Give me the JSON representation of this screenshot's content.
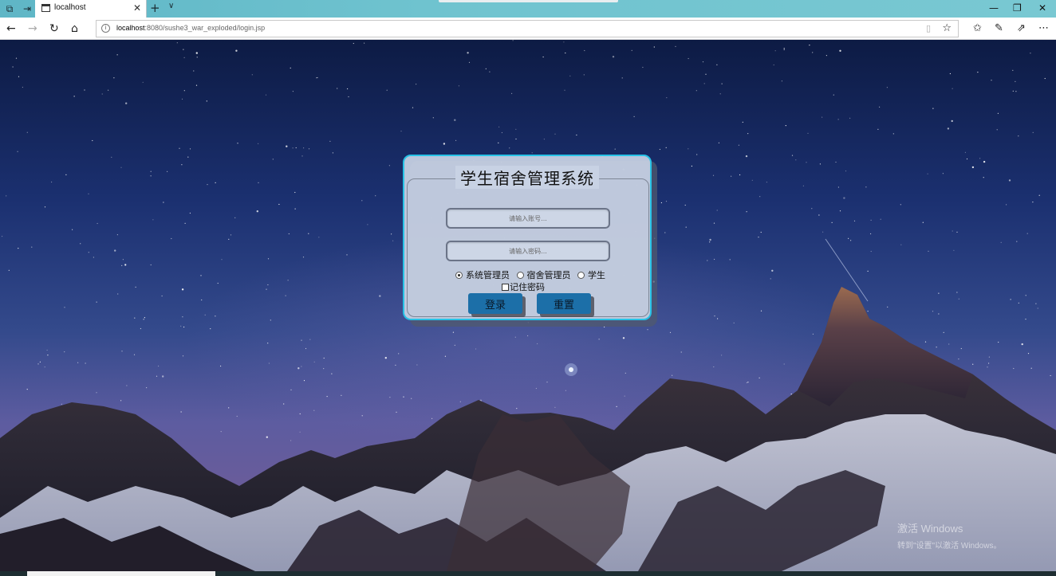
{
  "browser": {
    "tab_title": "localhost",
    "tab_close": "✕",
    "new_tab": "+",
    "tab_menu": "∨",
    "url_host": "localhost",
    "url_path": ":8080/sushe3_war_exploded/login.jsp",
    "window_controls": {
      "minimize": "—",
      "restore": "❐",
      "close": "✕"
    },
    "icons": {
      "tab_actions": "set-aside-tabs-icon",
      "back": "back-arrow-icon",
      "forward": "forward-arrow-icon",
      "refresh": "refresh-icon",
      "home": "home-icon",
      "reading_view": "reading-view-icon",
      "favorite": "star-icon",
      "favorites_hub": "favorites-hub-icon",
      "notes": "pen-icon",
      "share": "share-icon",
      "more": "more-icon"
    }
  },
  "login": {
    "title": "学生宿舍管理系统",
    "username_placeholder": "请输入账号...",
    "password_placeholder": "请输入密码...",
    "roles": [
      {
        "label": "系统管理员",
        "checked": true
      },
      {
        "label": "宿舍管理员",
        "checked": false
      },
      {
        "label": "学生",
        "checked": false
      }
    ],
    "remember_label": "记住密码",
    "login_button": "登录",
    "reset_button": "重置"
  },
  "watermark": {
    "line1": "激活 Windows",
    "line2": "转到\"设置\"以激活 Windows。"
  },
  "colors": {
    "card_border": "#27c2e6",
    "button_bg": "#1c6fa8",
    "tabbar": "#6fc3cf"
  }
}
